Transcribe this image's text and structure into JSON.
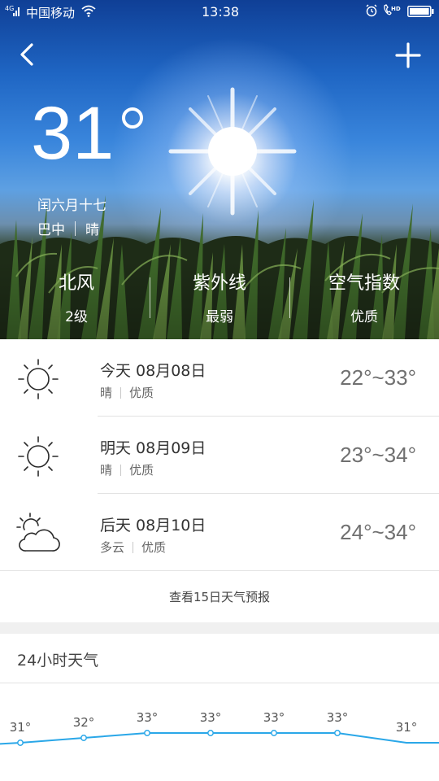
{
  "status_bar": {
    "carrier": "中国移动",
    "time": "13:38",
    "signal_tag": "4G",
    "call_tag": "HD"
  },
  "nav": {
    "back_icon": "chevron-left-icon",
    "add_icon": "plus-icon"
  },
  "current": {
    "temperature": "31",
    "lunar_date": "闰六月十七",
    "location": "巴中",
    "condition": "晴"
  },
  "metrics": [
    {
      "title": "北风",
      "value": "2级"
    },
    {
      "title": "紫外线",
      "value": "最弱"
    },
    {
      "title": "空气指数",
      "value": "优质"
    }
  ],
  "forecast": [
    {
      "title": "今天 08月08日",
      "condition": "晴",
      "air": "优质",
      "temp": "22°~33°",
      "icon": "sun-icon"
    },
    {
      "title": "明天 08月09日",
      "condition": "晴",
      "air": "优质",
      "temp": "23°~34°",
      "icon": "sun-icon"
    },
    {
      "title": "后天 08月10日",
      "condition": "多云",
      "air": "优质",
      "temp": "24°~34°",
      "icon": "partly-cloudy-icon"
    }
  ],
  "more_link": "查看15日天气预报",
  "hourly": {
    "title": "24小时天气",
    "temps": [
      31,
      32,
      33,
      33,
      33,
      33,
      31
    ],
    "labels": [
      "31°",
      "32°",
      "33°",
      "33°",
      "33°",
      "33°",
      "31°"
    ]
  },
  "colors": {
    "hourly_line": "#2aa7e8",
    "hourly_point_fill": "#ffffff"
  }
}
